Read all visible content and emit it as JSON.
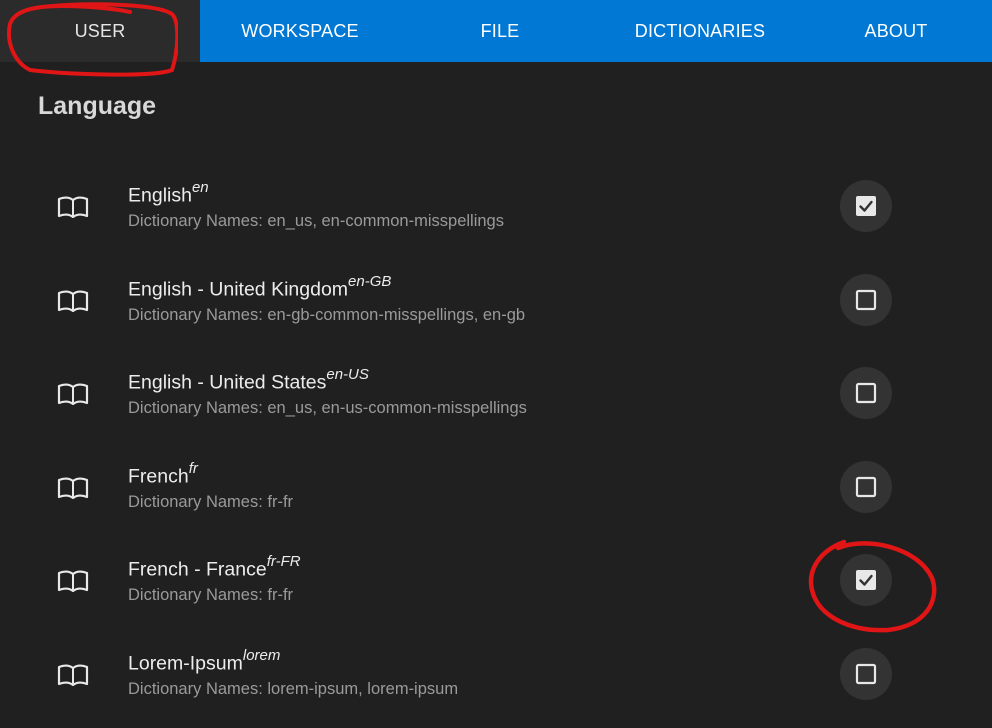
{
  "tabs": [
    {
      "label": "USER",
      "active": true
    },
    {
      "label": "WORKSPACE",
      "active": false
    },
    {
      "label": "FILE",
      "active": false
    },
    {
      "label": "DICTIONARIES",
      "active": false
    },
    {
      "label": "ABOUT",
      "active": false
    }
  ],
  "section_title": "Language",
  "languages": [
    {
      "name": "English",
      "code": "en",
      "dictionaries": "Dictionary Names: en_us, en-common-misspellings",
      "checked": true
    },
    {
      "name": "English - United Kingdom",
      "code": "en-GB",
      "dictionaries": "Dictionary Names: en-gb-common-misspellings, en-gb",
      "checked": false
    },
    {
      "name": "English - United States",
      "code": "en-US",
      "dictionaries": "Dictionary Names: en_us, en-us-common-misspellings",
      "checked": false
    },
    {
      "name": "French",
      "code": "fr",
      "dictionaries": "Dictionary Names: fr-fr",
      "checked": false
    },
    {
      "name": "French - France",
      "code": "fr-FR",
      "dictionaries": "Dictionary Names: fr-fr",
      "checked": true
    },
    {
      "name": "Lorem-Ipsum",
      "code": "lorem",
      "dictionaries": "Dictionary Names: lorem-ipsum, lorem-ipsum",
      "checked": false
    }
  ],
  "colors": {
    "tabbar": "#0078d4",
    "active_tab": "#2b2b2b",
    "background": "#202020",
    "annotation": "#e01515"
  },
  "icons": {
    "row_icon": "book-open-icon",
    "checked": "checkbox-checked-icon",
    "unchecked": "checkbox-unchecked-icon"
  }
}
